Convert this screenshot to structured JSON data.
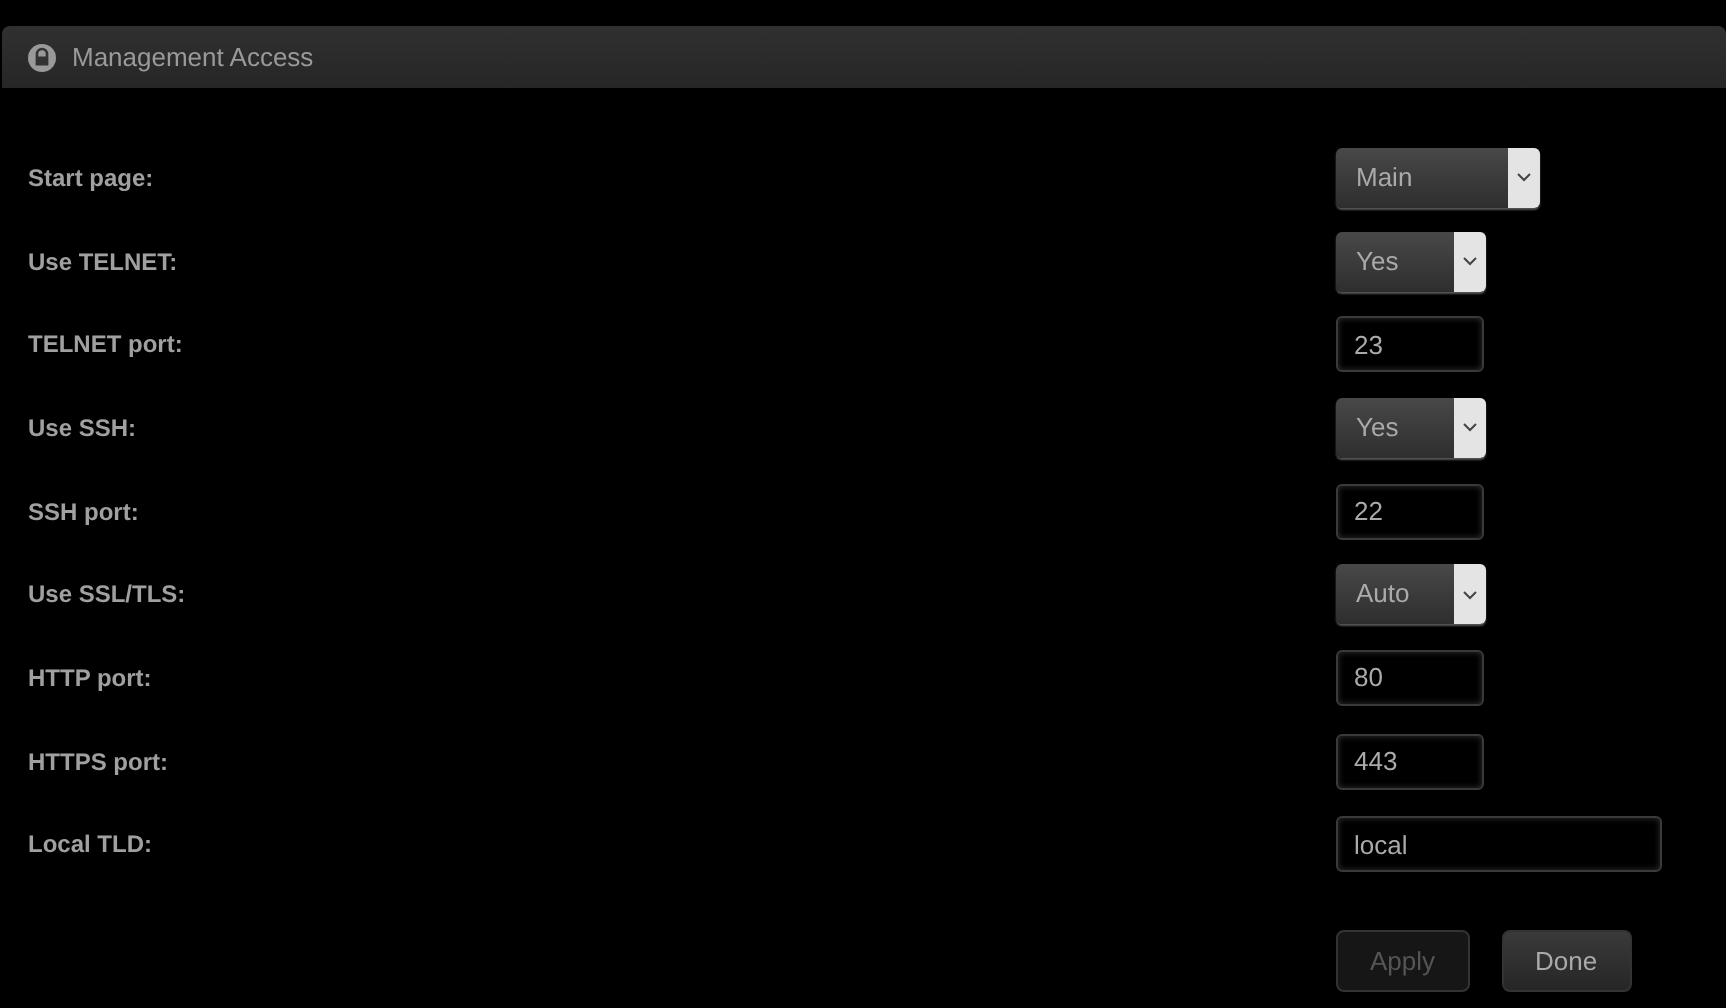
{
  "panel": {
    "title": "Management Access"
  },
  "fields": [
    {
      "label": "Start page:",
      "kind": "select",
      "value": "Main"
    },
    {
      "label": "Use TELNET:",
      "kind": "select",
      "value": "Yes"
    },
    {
      "label": "TELNET port:",
      "kind": "port",
      "value": "23"
    },
    {
      "label": "Use SSH:",
      "kind": "select",
      "value": "Yes"
    },
    {
      "label": "SSH port:",
      "kind": "port",
      "value": "22"
    },
    {
      "label": "Use SSL/TLS:",
      "kind": "select",
      "value": "Auto"
    },
    {
      "label": "HTTP port:",
      "kind": "port",
      "value": "80"
    },
    {
      "label": "HTTPS port:",
      "kind": "port",
      "value": "443"
    },
    {
      "label": "Local TLD:",
      "kind": "text",
      "value": "local"
    }
  ],
  "buttons": [
    {
      "label": "Apply",
      "disabled": true
    },
    {
      "label": "Done",
      "disabled": false
    }
  ]
}
